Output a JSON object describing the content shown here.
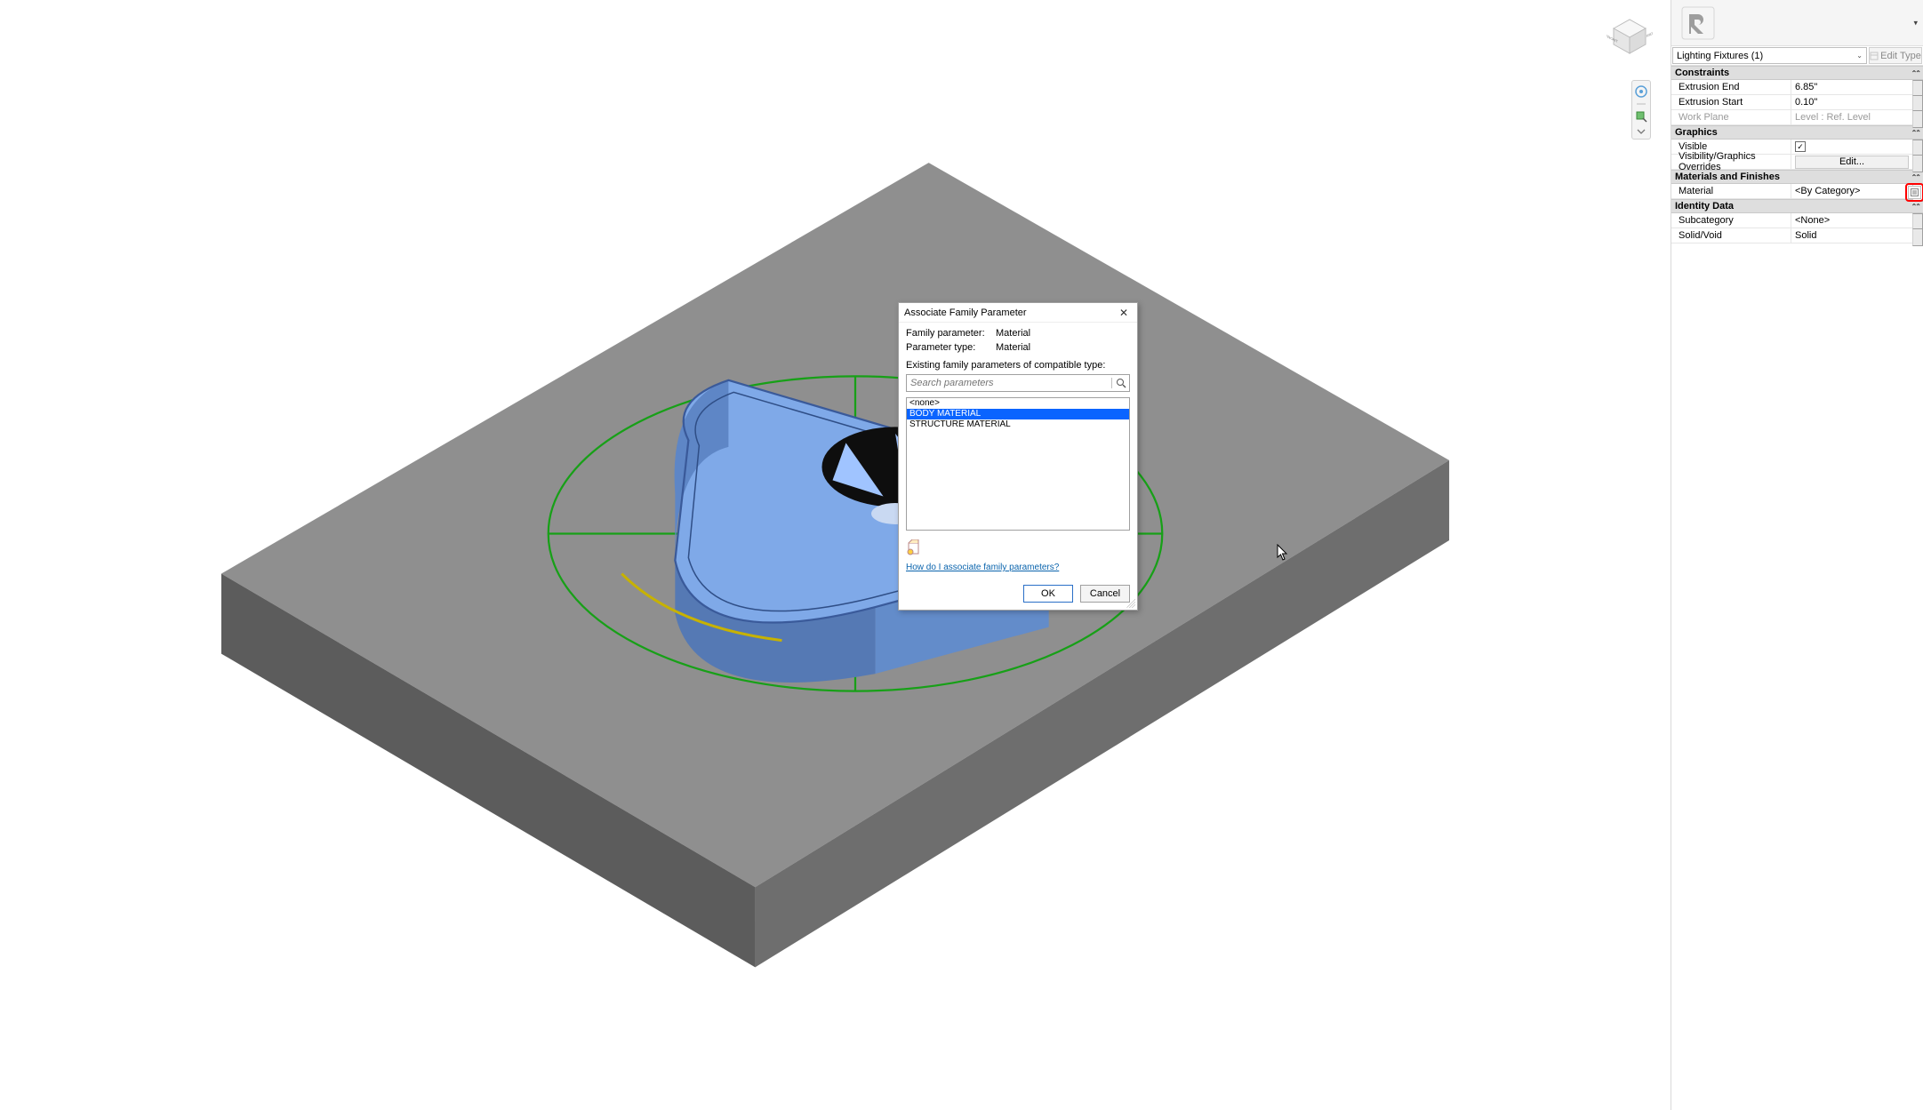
{
  "viewport": {
    "viewcube_faces": {
      "front": "FRONT",
      "right": "RIGHT",
      "top": ""
    }
  },
  "properties": {
    "type_selector": "Lighting Fixtures (1)",
    "edit_type": "Edit Type",
    "groups": {
      "constraints": {
        "title": "Constraints",
        "rows": {
          "extrusion_end": {
            "name": "Extrusion End",
            "value": "6.85\""
          },
          "extrusion_start": {
            "name": "Extrusion Start",
            "value": "0.10\""
          },
          "work_plane": {
            "name": "Work Plane",
            "value": "Level : Ref. Level"
          }
        }
      },
      "graphics": {
        "title": "Graphics",
        "rows": {
          "visible": {
            "name": "Visible",
            "checked": true
          },
          "overrides": {
            "name": "Visibility/Graphics Overrides",
            "button": "Edit..."
          }
        }
      },
      "materials": {
        "title": "Materials and Finishes",
        "rows": {
          "material": {
            "name": "Material",
            "value": "<By Category>"
          }
        }
      },
      "identity": {
        "title": "Identity Data",
        "rows": {
          "subcategory": {
            "name": "Subcategory",
            "value": "<None>"
          },
          "solid_void": {
            "name": "Solid/Void",
            "value": "Solid"
          }
        }
      }
    }
  },
  "dialog": {
    "title": "Associate Family Parameter",
    "family_param_label": "Family parameter:",
    "family_param_value": "Material",
    "param_type_label": "Parameter type:",
    "param_type_value": "Material",
    "existing_label": "Existing family parameters of compatible type:",
    "search_placeholder": "Search parameters",
    "items": [
      "<none>",
      "BODY MATERIAL",
      "STRUCTURE MATERIAL"
    ],
    "selected_index": 1,
    "help_link": "How do I associate family parameters?",
    "ok": "OK",
    "cancel": "Cancel"
  }
}
